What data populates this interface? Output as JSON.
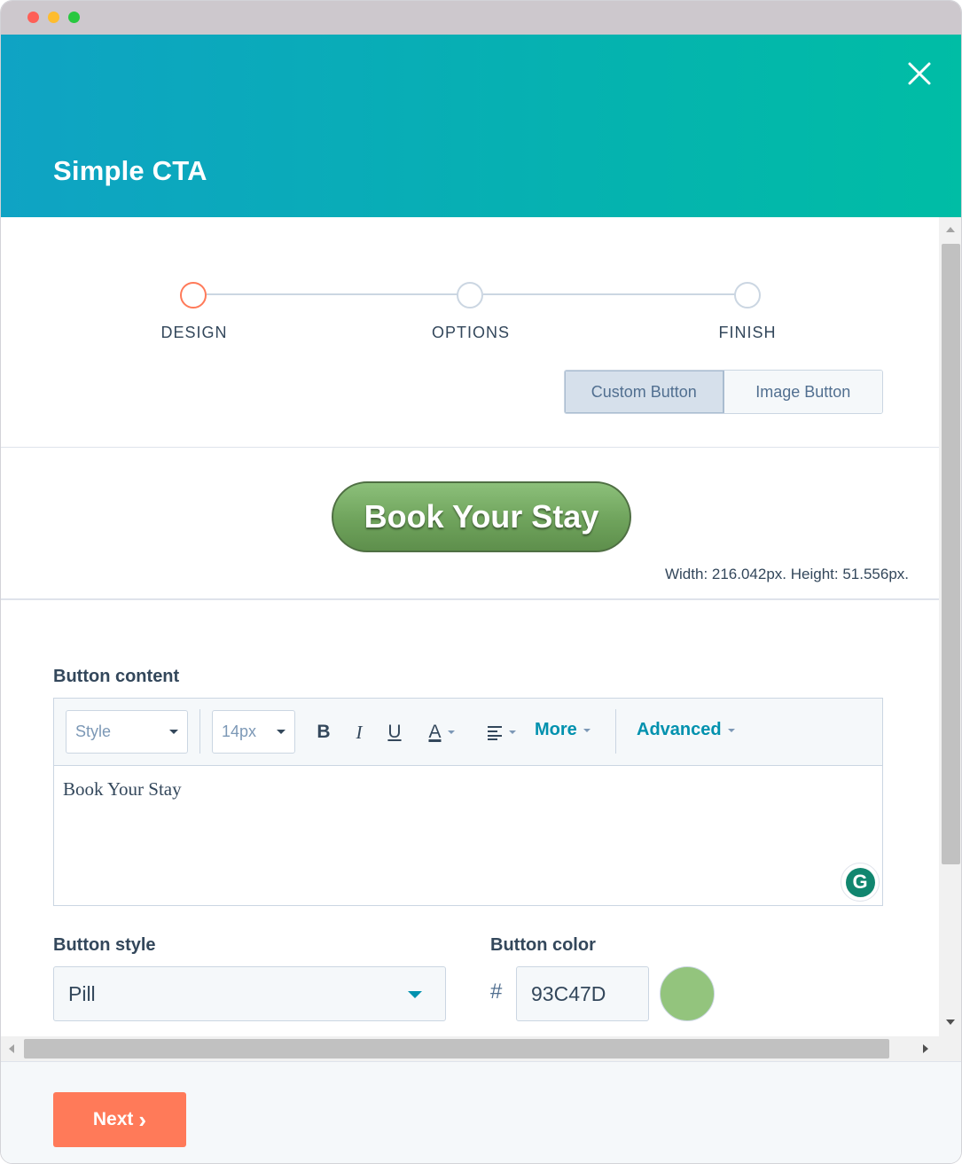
{
  "window": {
    "controls": [
      "close",
      "minimize",
      "zoom"
    ]
  },
  "header": {
    "title": "Simple CTA",
    "close_icon": "close-icon"
  },
  "stepper": {
    "steps": [
      {
        "label": "DESIGN",
        "active": true
      },
      {
        "label": "OPTIONS",
        "active": false
      },
      {
        "label": "FINISH",
        "active": false
      }
    ]
  },
  "button_type": {
    "options": [
      "Custom Button",
      "Image Button"
    ],
    "selected": "Custom Button"
  },
  "preview": {
    "button_text": "Book Your Stay",
    "dimensions": "Width: 216.042px. Height: 51.556px."
  },
  "button_content": {
    "label": "Button content",
    "toolbar": {
      "style_select": "Style",
      "size_select": "14px",
      "bold": "B",
      "italic": "I",
      "underline": "U",
      "text_color": "A",
      "more": "More",
      "advanced": "Advanced"
    },
    "text": "Book Your Stay",
    "grammarly_icon": "G"
  },
  "button_style": {
    "label": "Button style",
    "value": "Pill"
  },
  "button_color": {
    "label": "Button color",
    "hash": "#",
    "value": "93C47D",
    "swatch": "#93c47d"
  },
  "footer": {
    "next_label": "Next",
    "next_chevron": "›"
  },
  "colors": {
    "accent": "#ff7a59",
    "link": "#0091ae",
    "header_start": "#0fa3c4",
    "header_end": "#00bda5"
  }
}
